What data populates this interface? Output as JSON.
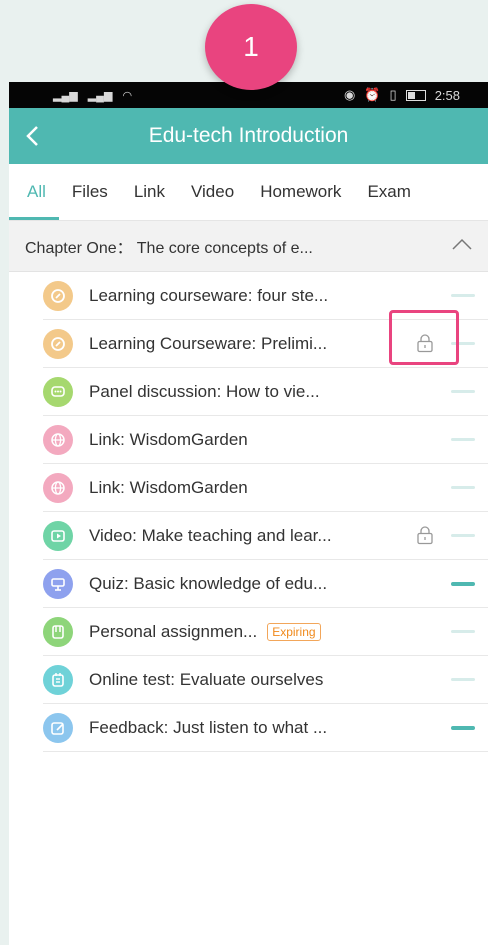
{
  "badge": {
    "number": "1"
  },
  "status_bar": {
    "time": "2:58"
  },
  "header": {
    "title": "Edu-tech Introduction"
  },
  "tabs": [
    {
      "label": "All",
      "active": true
    },
    {
      "label": "Files",
      "active": false
    },
    {
      "label": "Link",
      "active": false
    },
    {
      "label": "Video",
      "active": false
    },
    {
      "label": "Homework",
      "active": false
    },
    {
      "label": "Exam",
      "active": false
    }
  ],
  "chapter": {
    "title": "Chapter One： The core concepts of e..."
  },
  "items": [
    {
      "icon": "courseware-icon",
      "color": "#f3c98a",
      "label": "Learning courseware: four ste...",
      "locked": false,
      "progress": "not-started"
    },
    {
      "icon": "courseware-icon",
      "color": "#f3c98a",
      "label": "Learning Courseware: Prelimi...",
      "locked": true,
      "progress": "not-started"
    },
    {
      "icon": "discussion-icon",
      "color": "#a6d86f",
      "label": "Panel discussion: How to vie...",
      "locked": false,
      "progress": "not-started"
    },
    {
      "icon": "link-globe-icon",
      "color": "#f3a9bf",
      "label": "Link: WisdomGarden",
      "locked": false,
      "progress": "not-started"
    },
    {
      "icon": "link-globe-icon",
      "color": "#f3a9bf",
      "label": "Link: WisdomGarden",
      "locked": false,
      "progress": "not-started"
    },
    {
      "icon": "video-icon",
      "color": "#6fd4a6",
      "label": "Video: Make teaching and lear...",
      "locked": true,
      "progress": "not-started"
    },
    {
      "icon": "quiz-icon",
      "color": "#8ea1ee",
      "label": "Quiz: Basic knowledge of edu...",
      "locked": false,
      "progress": "completed"
    },
    {
      "icon": "assignment-icon",
      "color": "#8ed57a",
      "label": "Personal assignmen...",
      "tag": "Expiring",
      "locked": false,
      "progress": "not-started"
    },
    {
      "icon": "online-test-icon",
      "color": "#6fd2d8",
      "label": "Online test: Evaluate ourselves",
      "locked": false,
      "progress": "not-started"
    },
    {
      "icon": "feedback-icon",
      "color": "#8cc6ee",
      "label": "Feedback: Just listen to what ...",
      "locked": false,
      "progress": "completed"
    }
  ]
}
